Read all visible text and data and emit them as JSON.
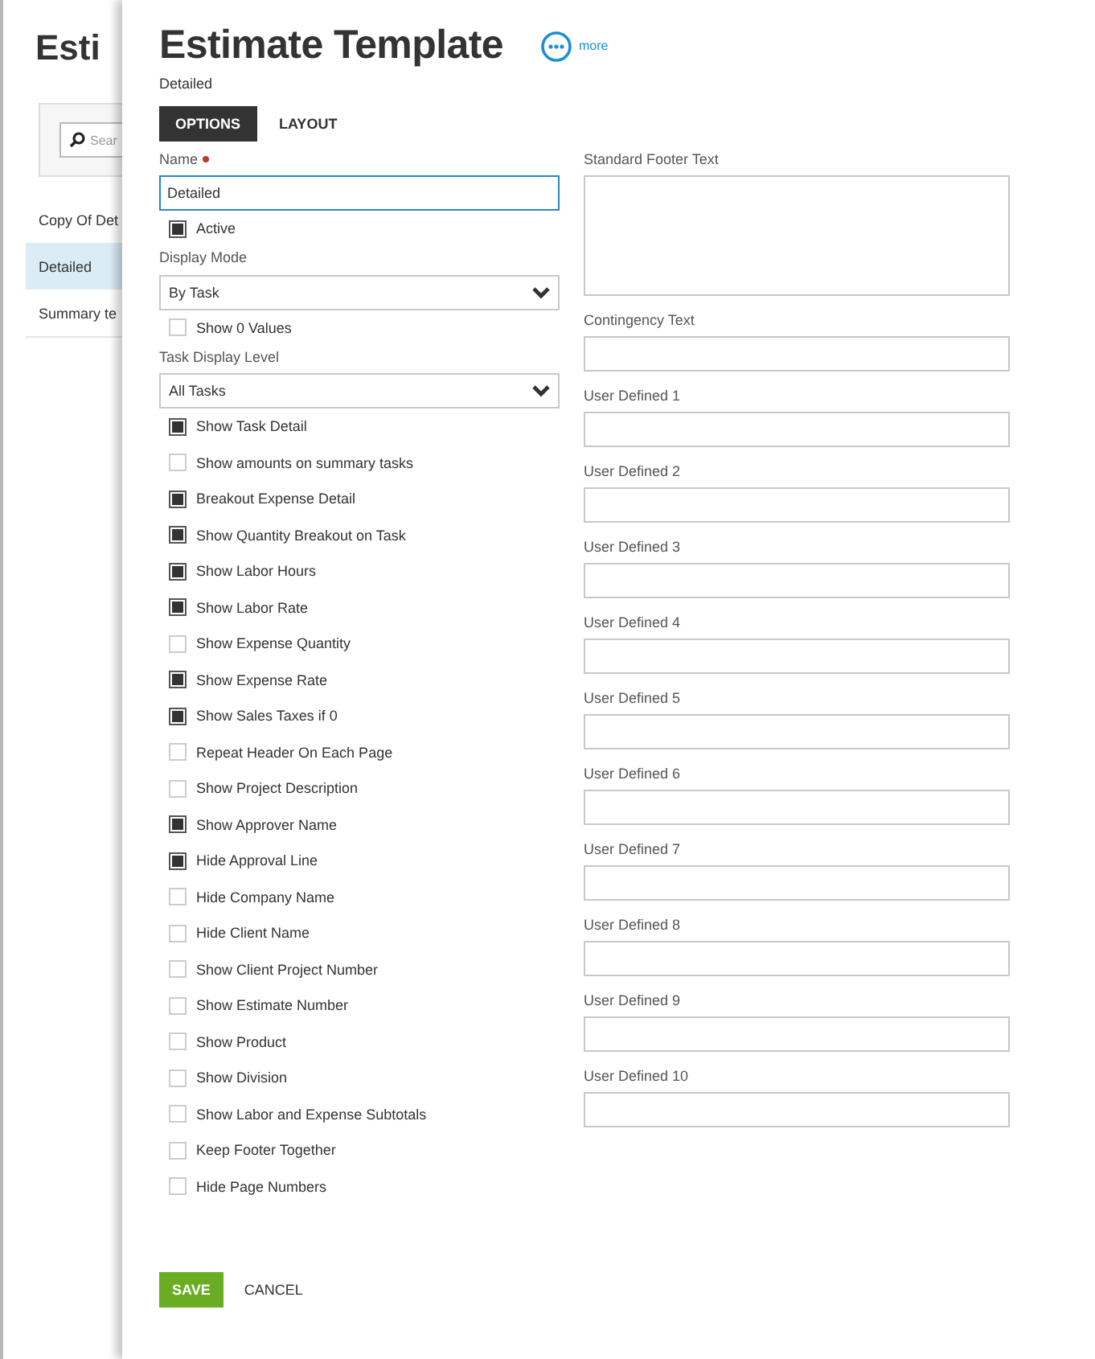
{
  "background_page": {
    "title": "Esti",
    "search": {
      "placeholder": "Sear"
    },
    "templates": [
      {
        "label": "Copy Of Det",
        "selected": false
      },
      {
        "label": "Detailed",
        "selected": true
      },
      {
        "label": "Summary te",
        "selected": false
      }
    ]
  },
  "panel": {
    "title": "Estimate Template",
    "more_label": "more",
    "subtitle": "Detailed",
    "tabs": [
      {
        "label": "OPTIONS",
        "selected": true
      },
      {
        "label": "LAYOUT",
        "selected": false
      }
    ],
    "name": {
      "label": "Name",
      "required": true,
      "value": "Detailed"
    },
    "active": {
      "label": "Active",
      "checked": true
    },
    "display_mode": {
      "label": "Display Mode",
      "value": "By Task"
    },
    "show_zero_values": {
      "label": "Show 0 Values",
      "checked": false
    },
    "task_display_level": {
      "label": "Task Display Level",
      "value": "All Tasks"
    },
    "options": [
      {
        "label": "Show Task Detail",
        "checked": true
      },
      {
        "label": "Show amounts on summary tasks",
        "checked": false
      },
      {
        "label": "Breakout Expense Detail",
        "checked": true
      },
      {
        "label": "Show Quantity Breakout on Task",
        "checked": true
      },
      {
        "label": "Show Labor Hours",
        "checked": true
      },
      {
        "label": "Show Labor Rate",
        "checked": true
      },
      {
        "label": "Show Expense Quantity",
        "checked": false
      },
      {
        "label": "Show Expense Rate",
        "checked": true
      },
      {
        "label": "Show Sales Taxes if 0",
        "checked": true
      },
      {
        "label": "Repeat Header On Each Page",
        "checked": false
      },
      {
        "label": "Show Project Description",
        "checked": false
      },
      {
        "label": "Show Approver Name",
        "checked": true
      },
      {
        "label": "Hide Approval Line",
        "checked": true
      },
      {
        "label": "Hide Company Name",
        "checked": false
      },
      {
        "label": "Hide Client Name",
        "checked": false
      },
      {
        "label": "Show Client Project Number",
        "checked": false
      },
      {
        "label": "Show Estimate Number",
        "checked": false
      },
      {
        "label": "Show Product",
        "checked": false
      },
      {
        "label": "Show Division",
        "checked": false
      },
      {
        "label": "Show Labor and Expense Subtotals",
        "checked": false
      },
      {
        "label": "Keep Footer Together",
        "checked": false
      },
      {
        "label": "Hide Page Numbers",
        "checked": false
      }
    ],
    "text_fields": [
      {
        "label": "Standard Footer Text",
        "kind": "textarea"
      },
      {
        "label": "Contingency Text",
        "kind": "input"
      },
      {
        "label": "User Defined 1",
        "kind": "input"
      },
      {
        "label": "User Defined 2",
        "kind": "input"
      },
      {
        "label": "User Defined 3",
        "kind": "input"
      },
      {
        "label": "User Defined 4",
        "kind": "input"
      },
      {
        "label": "User Defined 5",
        "kind": "input"
      },
      {
        "label": "User Defined 6",
        "kind": "input"
      },
      {
        "label": "User Defined 7",
        "kind": "input"
      },
      {
        "label": "User Defined 8",
        "kind": "input"
      },
      {
        "label": "User Defined 9",
        "kind": "input"
      },
      {
        "label": "User Defined 10",
        "kind": "input"
      }
    ],
    "buttons": [
      {
        "label": "SAVE",
        "kind": "primary"
      },
      {
        "label": "CANCEL",
        "kind": "plain"
      }
    ]
  }
}
